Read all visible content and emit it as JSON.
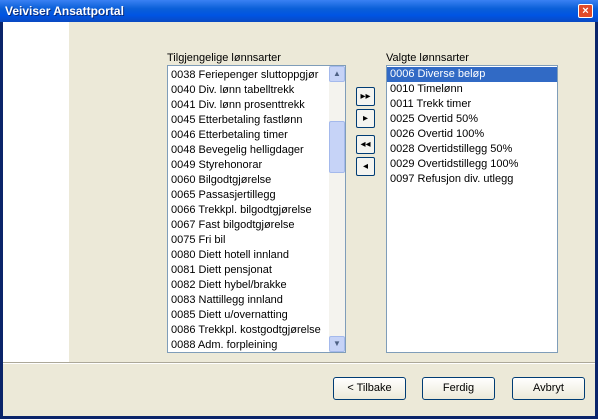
{
  "window": {
    "title": "Veiviser Ansattportal",
    "close_glyph": "×"
  },
  "available": {
    "label": "Tilgjengelige lønnsarter",
    "items": [
      "0038 Feriepenger sluttoppgjør",
      "0040 Div. lønn tabelltrekk",
      "0041 Div. lønn prosenttrekk",
      "0045 Etterbetaling fastlønn",
      "0046 Etterbetaling timer",
      "0048 Bevegelig helligdager",
      "0049 Styrehonorar",
      "0060 Bilgodtgjørelse",
      "0065 Passasjertillegg",
      "0066 Trekkpl. bilgodtgjørelse",
      "0067 Fast bilgodtgjørelse",
      "0075 Fri bil",
      "0080 Diett hotell innland",
      "0081 Diett pensjonat",
      "0082 Diett hybel/brakke",
      "0083 Nattillegg innland",
      "0085 Diett u/overnatting",
      "0086 Trekkpl. kostgodtgjørelse",
      "0088 Adm. forpleining"
    ]
  },
  "selected": {
    "label": "Valgte lønnsarter",
    "items": [
      "0006 Diverse beløp",
      "0010 Timelønn",
      "0011 Trekk timer",
      "0025 Overtid 50%",
      "0026 Overtid 100%",
      "0028 Overtidstillegg 50%",
      "0029 Overtidstillegg 100%",
      "0097 Refusjon div. utlegg"
    ],
    "highlighted_index": 0
  },
  "move_buttons": {
    "add_all": "▸▸",
    "add": "▸",
    "remove_all": "◂◂",
    "remove": "◂"
  },
  "footer": {
    "back": "< Tilbake",
    "finish": "Ferdig",
    "cancel": "Avbryt"
  },
  "colors": {
    "titlebar": "#0054e3",
    "selection": "#316ac5",
    "dialog_bg": "#ece9d8"
  }
}
